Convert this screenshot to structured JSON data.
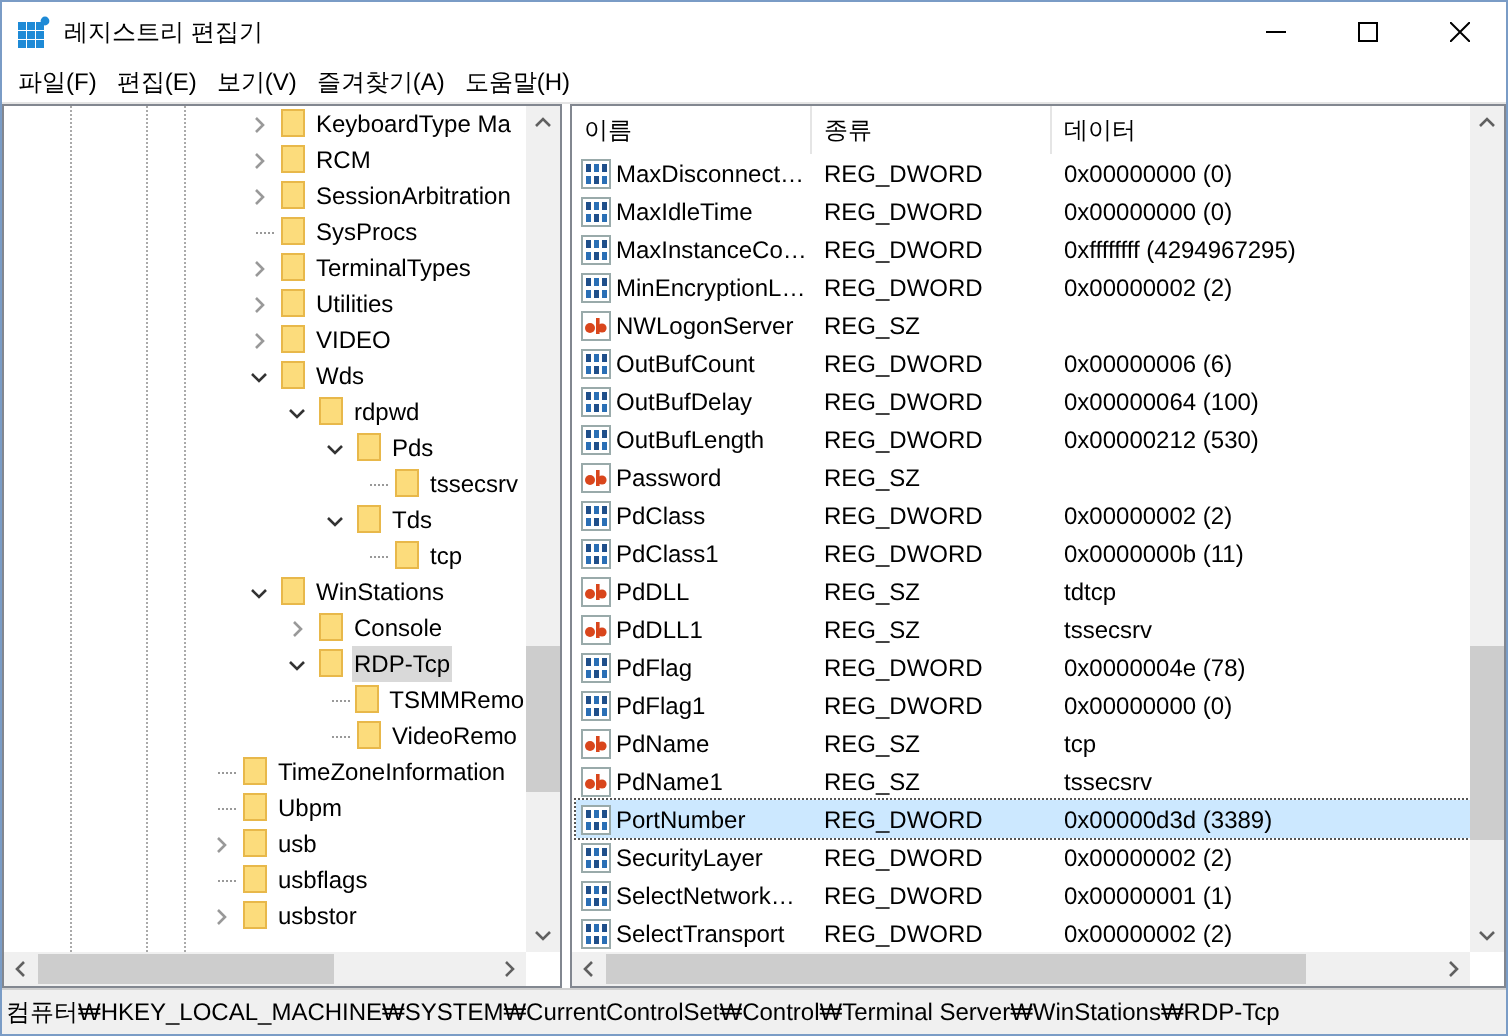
{
  "window": {
    "title": "레지스트리 편집기"
  },
  "menu": [
    "파일(F)",
    "편집(E)",
    "보기(V)",
    "즐겨찾기(A)",
    "도움말(H)"
  ],
  "tree": {
    "inner_items": [
      {
        "label": "KeyboardType Ma",
        "expanded": false,
        "selected": false
      },
      {
        "label": "RCM",
        "expanded": false,
        "selected": false
      },
      {
        "label": "SessionArbitration",
        "expanded": false,
        "selected": false
      },
      {
        "label": "SysProcs",
        "selected": false
      },
      {
        "label": "TerminalTypes",
        "expanded": false,
        "selected": false
      },
      {
        "label": "Utilities",
        "expanded": false,
        "selected": false
      },
      {
        "label": "VIDEO",
        "expanded": false,
        "selected": false
      },
      {
        "label": "Wds",
        "expanded": true,
        "selected": false,
        "children": [
          {
            "label": "rdpwd",
            "expanded": true,
            "selected": false,
            "children": [
              {
                "label": "Pds",
                "expanded": true,
                "selected": false,
                "children": [
                  {
                    "label": "tssecsrv",
                    "selected": false
                  }
                ]
              },
              {
                "label": "Tds",
                "expanded": true,
                "selected": false,
                "children": [
                  {
                    "label": "tcp",
                    "selected": false
                  }
                ]
              }
            ]
          }
        ]
      },
      {
        "label": "WinStations",
        "expanded": true,
        "selected": false,
        "children": [
          {
            "label": "Console",
            "expanded": false,
            "selected": false
          },
          {
            "label": "RDP-Tcp",
            "expanded": true,
            "selected": true,
            "children": [
              {
                "label": "TSMMRemo",
                "selected": false
              },
              {
                "label": "VideoRemo",
                "selected": false
              }
            ]
          }
        ]
      }
    ],
    "items": [
      {
        "label": "TimeZoneInformation",
        "selected": false
      },
      {
        "label": "Ubpm",
        "selected": false
      },
      {
        "label": "usb",
        "expanded": false,
        "selected": false
      },
      {
        "label": "usbflags",
        "selected": false
      },
      {
        "label": "usbstor",
        "expanded": false,
        "selected": false
      }
    ]
  },
  "table": {
    "columns": [
      "이름",
      "종류",
      "데이터"
    ],
    "rows": [
      {
        "kind": "dword",
        "name": "MaxDisconnect…",
        "type": "REG_DWORD",
        "data": "0x00000000 (0)",
        "selected": false
      },
      {
        "kind": "dword",
        "name": "MaxIdleTime",
        "type": "REG_DWORD",
        "data": "0x00000000 (0)",
        "selected": false
      },
      {
        "kind": "dword",
        "name": "MaxInstanceCo…",
        "type": "REG_DWORD",
        "data": "0xffffffff (4294967295)",
        "selected": false
      },
      {
        "kind": "dword",
        "name": "MinEncryptionL…",
        "type": "REG_DWORD",
        "data": "0x00000002 (2)",
        "selected": false
      },
      {
        "kind": "sz",
        "name": "NWLogonServer",
        "type": "REG_SZ",
        "selected": false
      },
      {
        "kind": "dword",
        "name": "OutBufCount",
        "type": "REG_DWORD",
        "data": "0x00000006 (6)",
        "selected": false
      },
      {
        "kind": "dword",
        "name": "OutBufDelay",
        "type": "REG_DWORD",
        "data": "0x00000064 (100)",
        "selected": false
      },
      {
        "kind": "dword",
        "name": "OutBufLength",
        "type": "REG_DWORD",
        "data": "0x00000212 (530)",
        "selected": false
      },
      {
        "kind": "sz",
        "name": "Password",
        "type": "REG_SZ",
        "selected": false
      },
      {
        "kind": "dword",
        "name": "PdClass",
        "type": "REG_DWORD",
        "data": "0x00000002 (2)",
        "selected": false
      },
      {
        "kind": "dword",
        "name": "PdClass1",
        "type": "REG_DWORD",
        "data": "0x0000000b (11)",
        "selected": false
      },
      {
        "kind": "sz",
        "name": "PdDLL",
        "type": "REG_SZ",
        "data": "tdtcp",
        "selected": false
      },
      {
        "kind": "sz",
        "name": "PdDLL1",
        "type": "REG_SZ",
        "data": "tssecsrv",
        "selected": false
      },
      {
        "kind": "dword",
        "name": "PdFlag",
        "type": "REG_DWORD",
        "data": "0x0000004e (78)",
        "selected": false
      },
      {
        "kind": "dword",
        "name": "PdFlag1",
        "type": "REG_DWORD",
        "data": "0x00000000 (0)",
        "selected": false
      },
      {
        "kind": "sz",
        "name": "PdName",
        "type": "REG_SZ",
        "data": "tcp",
        "selected": false
      },
      {
        "kind": "sz",
        "name": "PdName1",
        "type": "REG_SZ",
        "data": "tssecsrv",
        "selected": false
      },
      {
        "kind": "dword",
        "name": "PortNumber",
        "type": "REG_DWORD",
        "data": "0x00000d3d (3389)",
        "selected": true
      },
      {
        "kind": "dword",
        "name": "SecurityLayer",
        "type": "REG_DWORD",
        "data": "0x00000002 (2)",
        "selected": false
      },
      {
        "kind": "dword",
        "name": "SelectNetwork…",
        "type": "REG_DWORD",
        "data": "0x00000001 (1)",
        "selected": false
      },
      {
        "kind": "dword",
        "name": "SelectTransport",
        "type": "REG_DWORD",
        "data": "0x00000002 (2)",
        "selected": false
      }
    ]
  },
  "status_bar": "컴퓨터₩HKEY_LOCAL_MACHINE₩SYSTEM₩CurrentControlSet₩Control₩Terminal Server₩WinStations₩RDP-Tcp"
}
